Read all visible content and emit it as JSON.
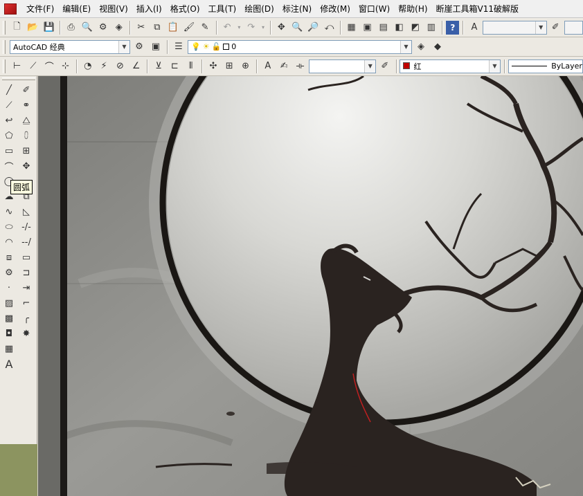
{
  "menubar": {
    "items": [
      "文件(F)",
      "编辑(E)",
      "视图(V)",
      "插入(I)",
      "格式(O)",
      "工具(T)",
      "绘图(D)",
      "标注(N)",
      "修改(M)",
      "窗口(W)",
      "帮助(H)",
      "断崖工具箱V11破解版"
    ]
  },
  "toolbar2": {
    "workspace": "AutoCAD 经典",
    "layer_value": "0"
  },
  "toolbar3": {
    "color_value": "红",
    "linetype_value": "ByLayer",
    "color_swatch": "#c00000"
  },
  "left_toolbar": {
    "tooltip": "圆弧",
    "text_tool": "A"
  },
  "colors": {
    "chrome": "#ece9e2",
    "menubar": "#f0f0f0",
    "canvas_stone": "#8a8a86",
    "deer": "#2a2320",
    "ring": "#1a1714"
  }
}
